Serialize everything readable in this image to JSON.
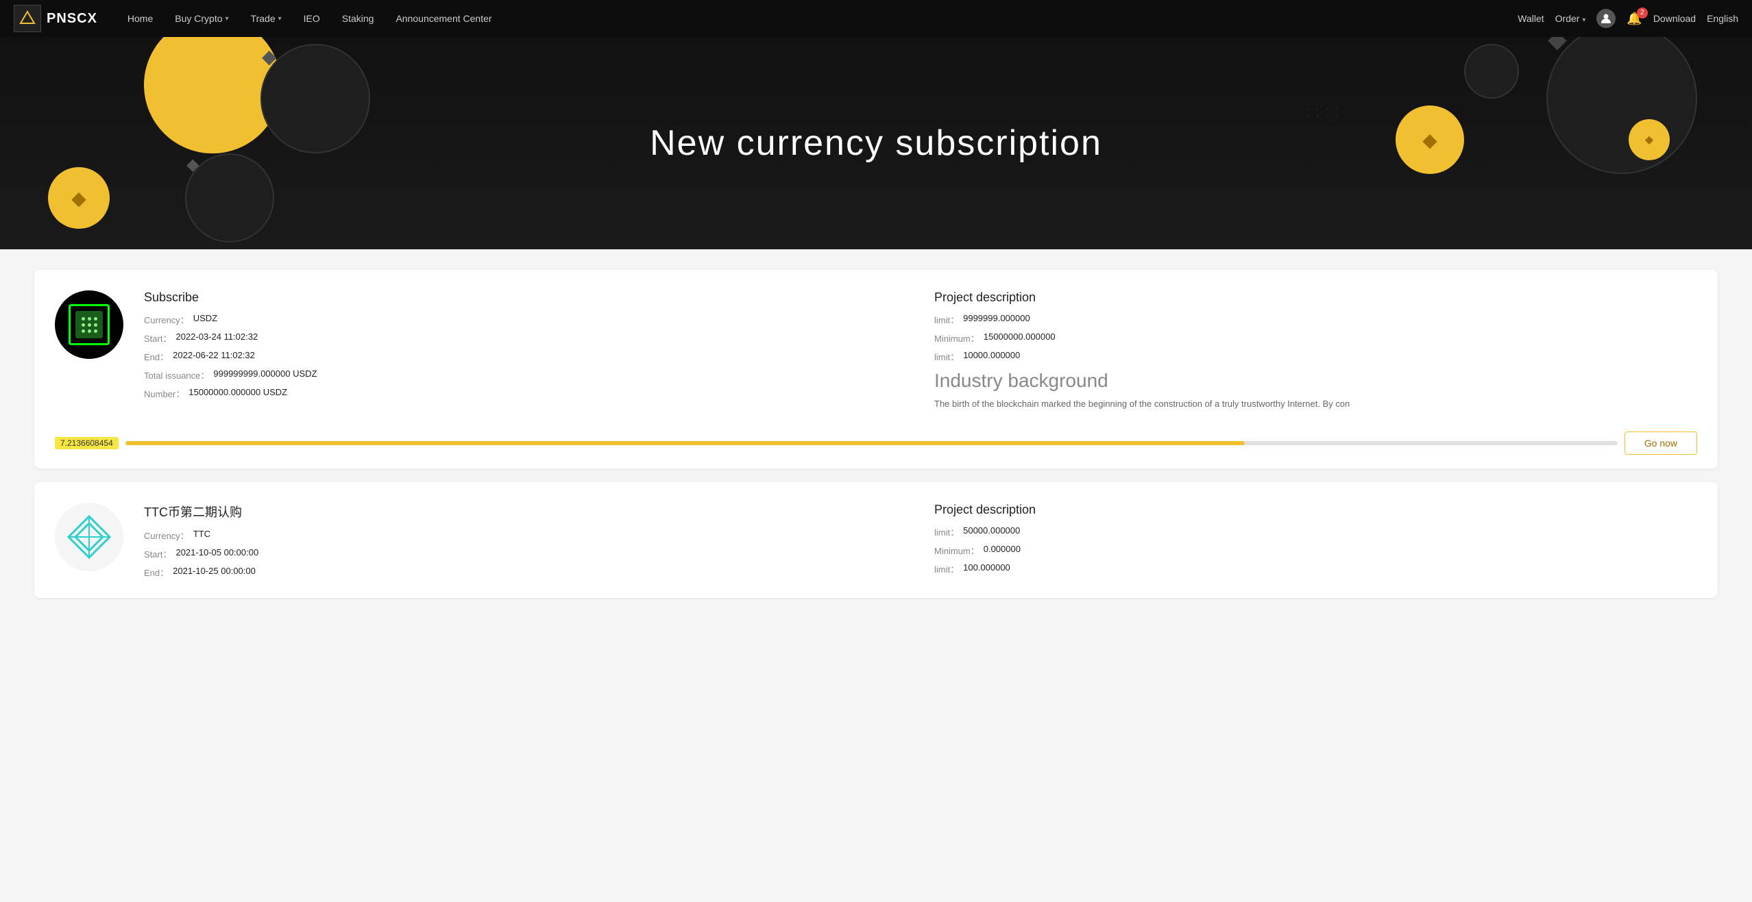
{
  "navbar": {
    "logo_text": "PNSCX",
    "links": [
      {
        "label": "Home",
        "has_arrow": false,
        "key": "home"
      },
      {
        "label": "Buy Crypto",
        "has_arrow": true,
        "key": "buy-crypto"
      },
      {
        "label": "Trade",
        "has_arrow": true,
        "key": "trade"
      },
      {
        "label": "IEO",
        "has_arrow": false,
        "key": "ieo"
      },
      {
        "label": "Staking",
        "has_arrow": false,
        "key": "staking"
      },
      {
        "label": "Announcement Center",
        "has_arrow": false,
        "key": "announcement"
      }
    ],
    "right": {
      "wallet": "Wallet",
      "order": "Order",
      "bell_count": "2",
      "download": "Download",
      "language": "English"
    }
  },
  "hero": {
    "title": "New currency subscription"
  },
  "cards": [
    {
      "id": "usdz-card",
      "icon_type": "usdz",
      "left": {
        "section_title": "Subscribe",
        "rows": [
          {
            "label": "Currency：",
            "value": "USDZ"
          },
          {
            "label": "Start：",
            "value": "2022-03-24 11:02:32"
          },
          {
            "label": "End：",
            "value": "2022-06-22 11:02:32"
          },
          {
            "label": "Total issuance：",
            "value": "999999999.000000 USDZ"
          },
          {
            "label": "Number：",
            "value": "15000000.000000 USDZ"
          }
        ]
      },
      "right": {
        "section_title": "Project description",
        "rows": [
          {
            "label": "limit：",
            "value": "9999999.000000"
          },
          {
            "label": "Minimum：",
            "value": "15000000.000000"
          },
          {
            "label": "limit：",
            "value": "10000.000000"
          }
        ],
        "industry_title": "Industry background",
        "industry_text": "The birth of the blockchain marked the beginning of the construction of a truly trustworthy Internet. By con"
      },
      "progress": {
        "value": "7.2136608454",
        "fill_percent": 75
      },
      "go_now": "Go now"
    },
    {
      "id": "ttc-card",
      "icon_type": "ttc",
      "left": {
        "section_title": "TTC币第二期认购",
        "rows": [
          {
            "label": "Currency：",
            "value": "TTC"
          },
          {
            "label": "Start：",
            "value": "2021-10-05 00:00:00"
          },
          {
            "label": "End：",
            "value": "2021-10-25 00:00:00"
          }
        ]
      },
      "right": {
        "section_title": "Project description",
        "rows": [
          {
            "label": "limit：",
            "value": "50000.000000"
          },
          {
            "label": "Minimum：",
            "value": "0.000000"
          },
          {
            "label": "limit：",
            "value": "100.000000"
          }
        ],
        "industry_title": "",
        "industry_text": ""
      },
      "progress": null,
      "go_now": null
    }
  ]
}
